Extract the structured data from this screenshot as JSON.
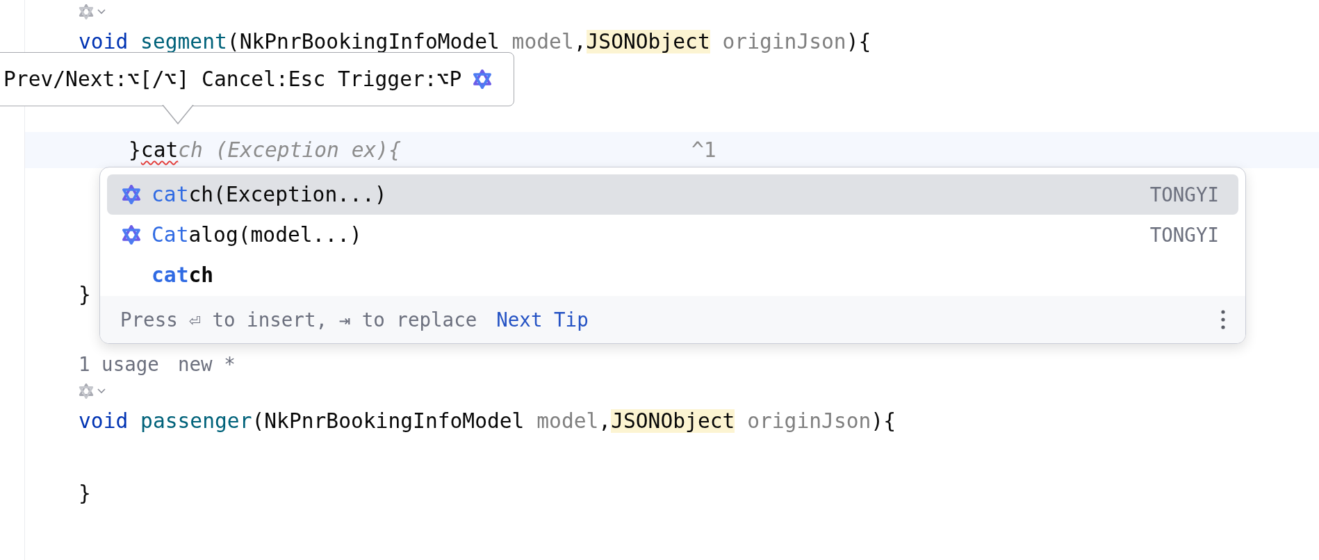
{
  "editor": {
    "lines": [
      {
        "kind": "gutter_icon"
      },
      {
        "kind": "code",
        "tokens": [
          {
            "text": "void ",
            "kind": "keyword"
          },
          {
            "text": "segment",
            "kind": "function"
          },
          {
            "text": "(NkPnrBookingInfoModel ",
            "kind": "plain"
          },
          {
            "text": "model",
            "kind": "param"
          },
          {
            "text": ",",
            "kind": "plain"
          },
          {
            "text": "JSONObject",
            "kind": "highlight"
          },
          {
            "text": " originJson",
            "kind": "param"
          },
          {
            "text": "){",
            "kind": "plain"
          }
        ],
        "children": [
          {
            "kind": "blank"
          },
          {
            "kind": "blank"
          },
          {
            "kind": "code",
            "current": true,
            "tokens": [
              {
                "text": "}",
                "kind": "plain"
              },
              {
                "text": "cat",
                "kind": "error"
              }
            ],
            "suggestion": "ch (Exception ex){",
            "hint": "^1"
          },
          {
            "kind": "blank"
          },
          {
            "kind": "blank"
          },
          {
            "kind": "blank"
          }
        ]
      },
      {
        "kind": "code",
        "tokens": [
          {
            "text": "}",
            "kind": "plain"
          }
        ]
      },
      {
        "kind": "blank"
      },
      {
        "kind": "inlay",
        "texts": [
          "1 usage",
          "new *"
        ]
      },
      {
        "kind": "gutter_icon"
      },
      {
        "kind": "code",
        "tokens": [
          {
            "text": "void ",
            "kind": "keyword"
          },
          {
            "text": "passenger",
            "kind": "function"
          },
          {
            "text": "(NkPnrBookingInfoModel ",
            "kind": "plain"
          },
          {
            "text": "model",
            "kind": "param"
          },
          {
            "text": ",",
            "kind": "plain"
          },
          {
            "text": "JSONObject",
            "kind": "highlight"
          },
          {
            "text": " originJson",
            "kind": "param"
          },
          {
            "text": "){",
            "kind": "plain"
          }
        ],
        "children": [
          {
            "kind": "blank"
          }
        ]
      },
      {
        "kind": "code",
        "tokens": [
          {
            "text": "}",
            "kind": "plain"
          }
        ]
      }
    ]
  },
  "tooltip": {
    "text": "Prev/Next:⌥[/⌥] Cancel:Esc Trigger:⌥P"
  },
  "popup": {
    "items": [
      {
        "kind": "ai",
        "match": "cat",
        "rest": "ch(Exception...)",
        "source": "TONGYI",
        "selected": true
      },
      {
        "kind": "ai",
        "match": "Cat",
        "rest": "alog(model...)",
        "source": "TONGYI",
        "selected": false
      },
      {
        "kind": "keyword",
        "match": "cat",
        "rest": "ch",
        "selected": false
      }
    ],
    "footer": {
      "hint": "Press ⏎ to insert, ⇥ to replace",
      "link": "Next Tip"
    }
  }
}
